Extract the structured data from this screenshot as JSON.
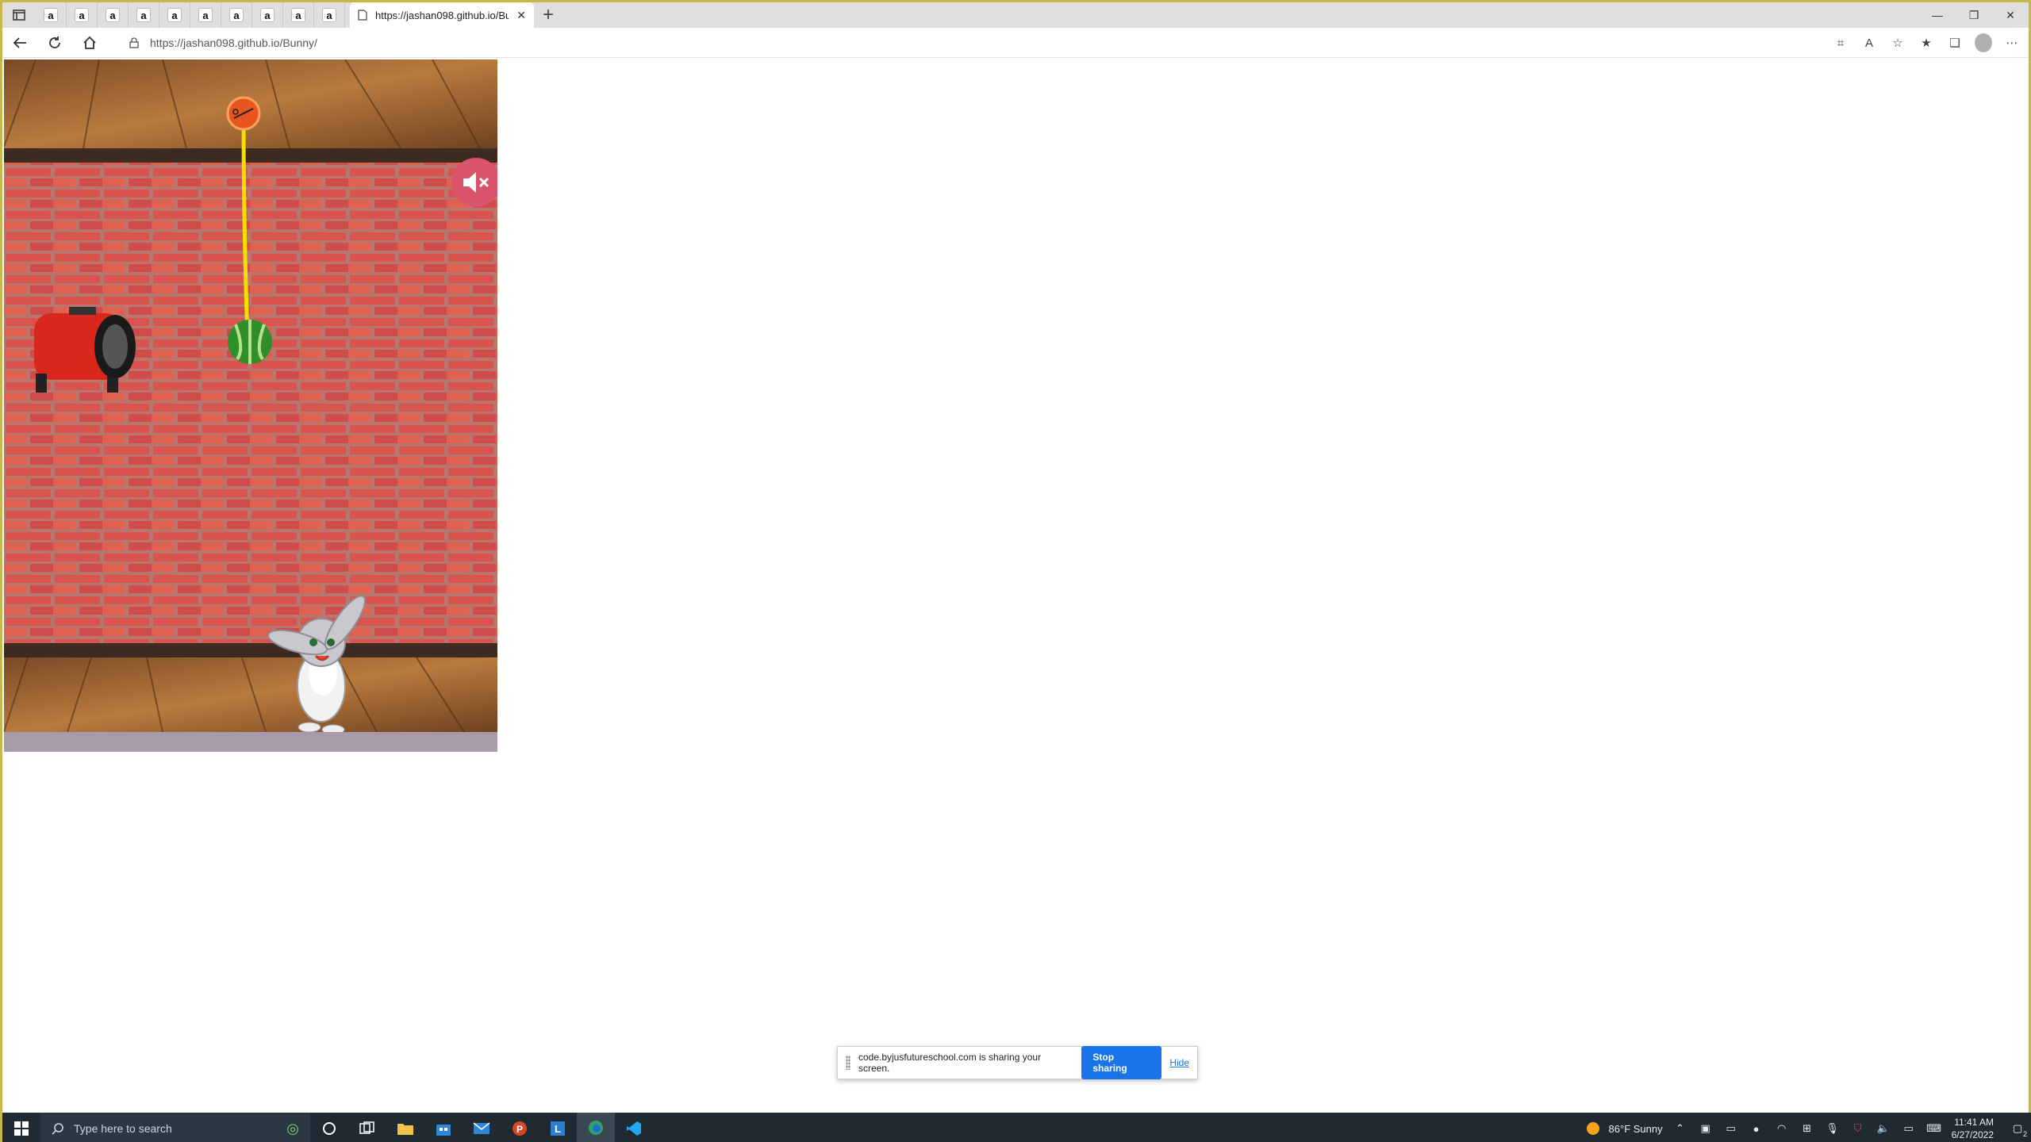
{
  "browser": {
    "tab_favicon_letter": "a",
    "mini_tab_count": 10,
    "active_tab_title": "https://jashan098.github.io/Bunny/",
    "url": "https://jashan098.github.io/Bunny/"
  },
  "game": {
    "mute_icon": "speaker-muted-icon",
    "objects": [
      "cut-button",
      "rope",
      "watermelon",
      "air-blower",
      "bunny"
    ]
  },
  "share_bar": {
    "message": "code.byjusfutureschool.com is sharing your screen.",
    "stop_label": "Stop sharing",
    "hide_label": "Hide"
  },
  "taskbar": {
    "search_placeholder": "Type here to search",
    "weather": "86°F  Sunny",
    "time": "11:41 AM",
    "date": "6/27/2022",
    "notification_count": "2"
  }
}
